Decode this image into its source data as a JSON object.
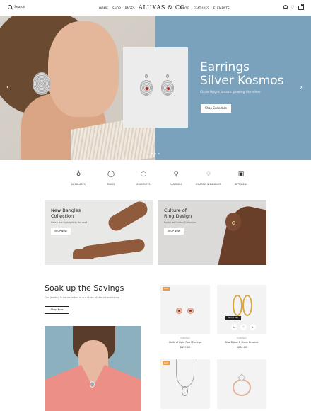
{
  "header": {
    "search_label": "Search",
    "nav_left": [
      "HOME",
      "SHOP",
      "PAGES"
    ],
    "logo": "ALUKAS & CO",
    "nav_right": [
      "BLOG",
      "FEATURES",
      "ELEMENTS"
    ],
    "cart_count": "0"
  },
  "hero": {
    "title_line1": "Earrings",
    "title_line2": "Silver Kosmos",
    "subtitle": "Circle Bright bronze glowing like silver",
    "button": "Shop Collection",
    "prev_arrow": "‹",
    "next_arrow": "›"
  },
  "categories": [
    {
      "label": "NECKLACES",
      "icon": "necklace-icon"
    },
    {
      "label": "RINGS",
      "icon": "ring-icon"
    },
    {
      "label": "BRACELETS",
      "icon": "bracelet-icon"
    },
    {
      "label": "EARRINGS",
      "icon": "earrings-icon"
    },
    {
      "label": "CHARMS & DANGLES",
      "icon": "charm-icon"
    },
    {
      "label": "GIFT IDEAS",
      "icon": "gift-icon"
    }
  ],
  "banners": [
    {
      "title_line1": "New Bangles",
      "title_line2": "Collection",
      "subtitle": "Catch the highlight in the roof",
      "button": "SHOP NOW"
    },
    {
      "title_line1": "Culture of",
      "title_line2": "Ring Design",
      "subtitle": "Rocks de Cartier Collection",
      "button": "SHOP NOW"
    }
  ],
  "savings": {
    "title": "Soak up the Savings",
    "subtitle": "Our jewelry is handcrafted in our state-of-the-art workshop",
    "button": "Shop Now"
  },
  "products": [
    {
      "badge": "SALE",
      "category": "EARRINGS",
      "name": "Circle of Light Pearl Earrings",
      "price": "$159.00"
    },
    {
      "badge": "",
      "category": "EARRINGS",
      "name": "Blue Bijoux & Stone Bracelet",
      "price": "$234.00",
      "tooltip": "Add to Cart"
    },
    {
      "badge": "SALE",
      "category": "",
      "name": "",
      "price": ""
    },
    {
      "badge": "",
      "category": "",
      "name": "",
      "price": ""
    }
  ],
  "colors": {
    "hero_right_bg": "#7aa2bd",
    "badge": "#e89b4b",
    "accent_dark": "#222222"
  }
}
